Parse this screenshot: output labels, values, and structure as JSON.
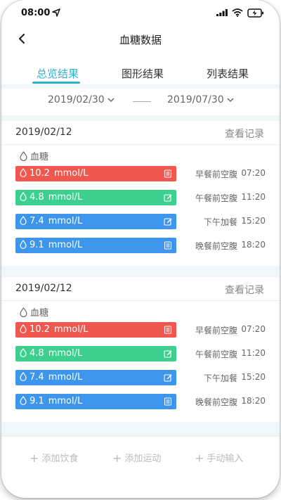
{
  "status": {
    "time": "08:00"
  },
  "header": {
    "title": "血糖数据"
  },
  "tabs": [
    {
      "label": "总览结果",
      "active": true
    },
    {
      "label": "图形结果",
      "active": false
    },
    {
      "label": "列表结果",
      "active": false
    }
  ],
  "date_range": {
    "start": "2019/02/30",
    "end": "2019/07/30"
  },
  "cards": [
    {
      "date": "2019/02/12",
      "link": "查看记录",
      "category": "血糖",
      "records": [
        {
          "value": "10.2",
          "unit": "mmol/L",
          "color": "#f0584f",
          "icon": "document-icon",
          "meal": "早餐前空腹",
          "time": "07:20"
        },
        {
          "value": "4.8",
          "unit": "mmol/L",
          "color": "#3ccf8e",
          "icon": "edit-icon",
          "meal": "午餐前空腹",
          "time": "11:20"
        },
        {
          "value": "7.4",
          "unit": "mmol/L",
          "color": "#3d95ec",
          "icon": "edit-icon",
          "meal": "下午加餐",
          "time": "15:20"
        },
        {
          "value": "9.1",
          "unit": "mmol/L",
          "color": "#3d95ec",
          "icon": "document-icon",
          "meal": "晚餐前空腹",
          "time": "18:20"
        }
      ]
    },
    {
      "date": "2019/02/12",
      "link": "查看记录",
      "category": "血糖",
      "records": [
        {
          "value": "10.2",
          "unit": "mmol/L",
          "color": "#f0584f",
          "icon": "document-icon",
          "meal": "早餐前空腹",
          "time": "07:20"
        },
        {
          "value": "4.8",
          "unit": "mmol/L",
          "color": "#3ccf8e",
          "icon": "edit-icon",
          "meal": "午餐前空腹",
          "time": "11:20"
        },
        {
          "value": "7.4",
          "unit": "mmol/L",
          "color": "#3d95ec",
          "icon": "edit-icon",
          "meal": "下午加餐",
          "time": "15:20"
        },
        {
          "value": "9.1",
          "unit": "mmol/L",
          "color": "#3d95ec",
          "icon": "document-icon",
          "meal": "晚餐前空腹",
          "time": "18:20"
        }
      ]
    }
  ],
  "actions": [
    {
      "label": "添加饮食"
    },
    {
      "label": "添加运动"
    },
    {
      "label": "手动输入"
    }
  ],
  "accent_color": "#2fb2c9"
}
